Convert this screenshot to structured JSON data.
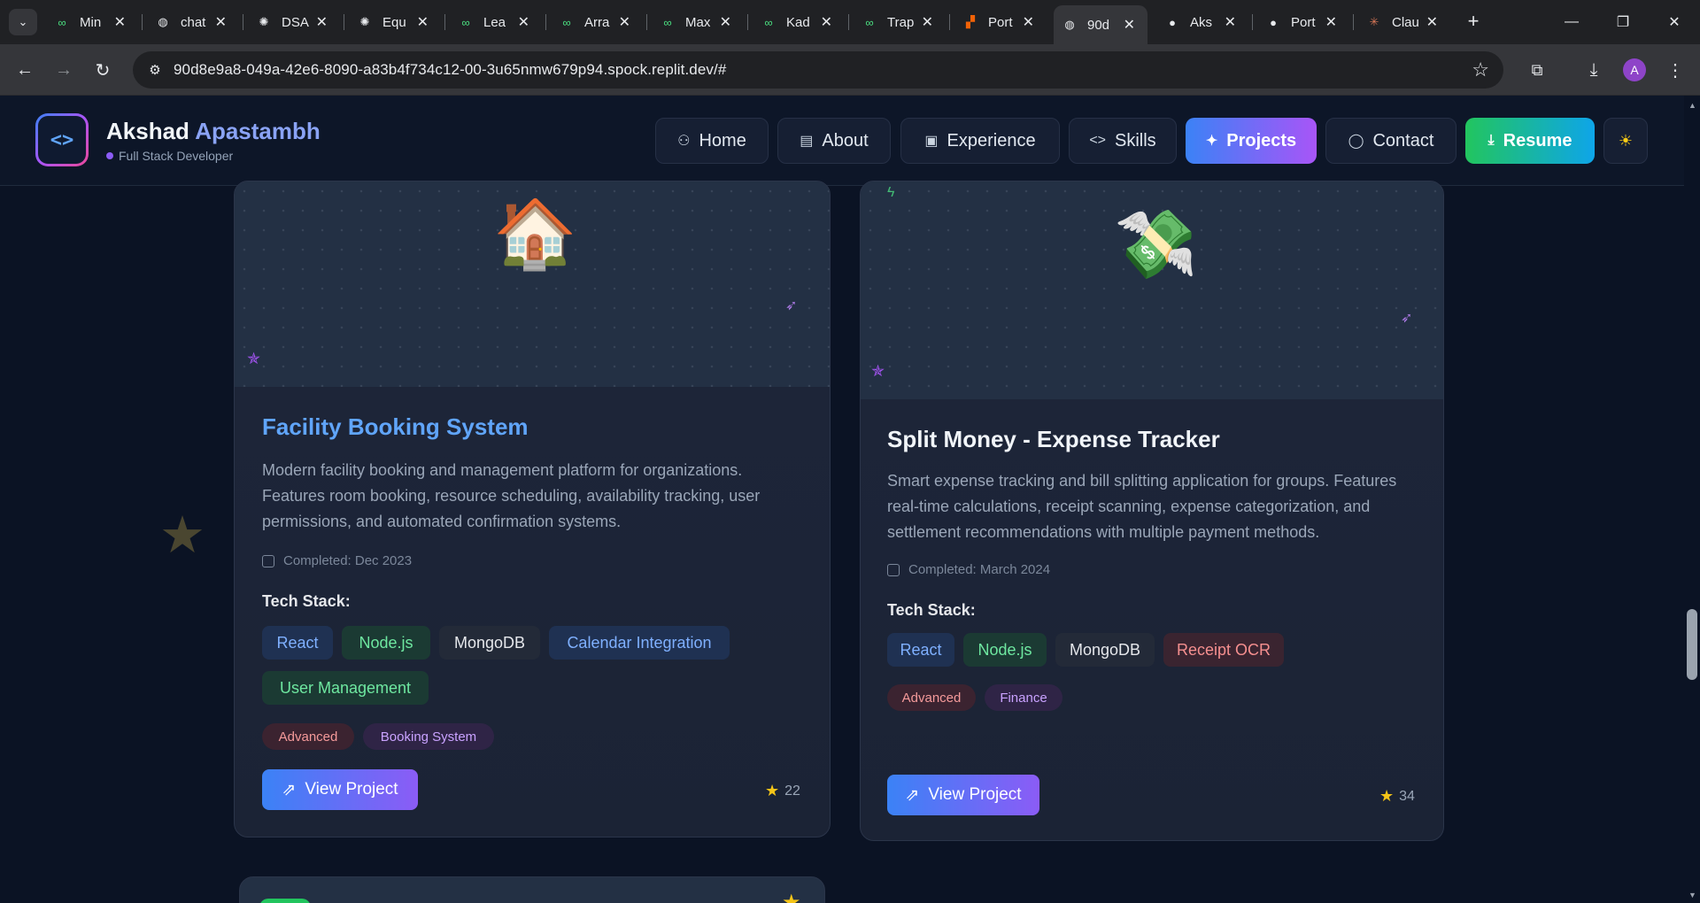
{
  "browser": {
    "tabs": [
      {
        "label": "Min",
        "icon": "leetcode-icon"
      },
      {
        "label": "chat",
        "icon": "globe-icon"
      },
      {
        "label": "DSA",
        "icon": "openai-icon"
      },
      {
        "label": "Equ",
        "icon": "openai-icon"
      },
      {
        "label": "Lea",
        "icon": "leetcode-icon"
      },
      {
        "label": "Arra",
        "icon": "leetcode-icon"
      },
      {
        "label": "Max",
        "icon": "leetcode-icon"
      },
      {
        "label": "Kad",
        "icon": "leetcode-icon"
      },
      {
        "label": "Trap",
        "icon": "leetcode-icon"
      },
      {
        "label": "Port",
        "icon": "replit-icon"
      },
      {
        "label": "90d",
        "icon": "globe-icon",
        "active": true
      },
      {
        "label": "Aks",
        "icon": "github-icon"
      },
      {
        "label": "Port",
        "icon": "github-icon"
      },
      {
        "label": "Clau",
        "icon": "claude-icon"
      }
    ],
    "url": "90d8e9a8-049a-42e6-8090-a83b4f734c12-00-3u65nmw679p94.spock.replit.dev/#",
    "profile_initial": "A"
  },
  "header": {
    "brand_first": "Akshad",
    "brand_last": "Apastambh",
    "subtitle": "Full Stack Developer",
    "nav": {
      "home": "Home",
      "about": "About",
      "experience": "Experience",
      "skills": "Skills",
      "projects": "Projects",
      "contact": "Contact",
      "resume": "Resume"
    }
  },
  "projects": [
    {
      "title": "Facility Booking System",
      "title_color": "#60a5fa",
      "description": "Modern facility booking and management platform for organizations. Features room booking, resource scheduling, availability tracking, user permissions, and automated confirmation systems.",
      "completed": "Completed: Dec 2023",
      "tech_label": "Tech Stack:",
      "tech": [
        "React",
        "Node.js",
        "MongoDB",
        "Calendar Integration",
        "User Management"
      ],
      "tags": [
        "Advanced",
        "Booking System"
      ],
      "button": "View Project",
      "stars": "22",
      "emoji": "🏠"
    },
    {
      "title": "Split Money - Expense Tracker",
      "title_color": "#f1f5f9",
      "description": "Smart expense tracking and bill splitting application for groups. Features real-time calculations, receipt scanning, expense categorization, and settlement recommendations with multiple payment methods.",
      "completed": "Completed: March 2024",
      "tech_label": "Tech Stack:",
      "tech": [
        "React",
        "Node.js",
        "MongoDB",
        "Receipt OCR"
      ],
      "tags": [
        "Advanced",
        "Finance"
      ],
      "button": "View Project",
      "stars": "34",
      "emoji": "💸"
    }
  ]
}
